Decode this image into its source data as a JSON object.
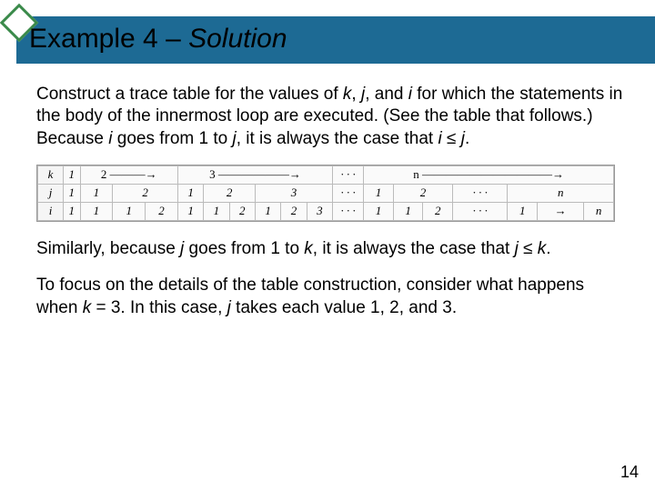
{
  "header": {
    "title_prefix": "Example 4",
    "title_sep": " – ",
    "title_suffix": "Solution"
  },
  "paragraphs": {
    "p1_a": "Construct a trace table for the values of ",
    "p1_k": "k",
    "p1_b": ", ",
    "p1_j": "j",
    "p1_c": ", and ",
    "p1_i": "i",
    "p1_d": " for which the statements in the body of the innermost loop are executed. (See the table that follows.) Because ",
    "p1_i2": "i",
    "p1_e": " goes from 1 to ",
    "p1_j2": "j",
    "p1_f": ", it is always the case that ",
    "p1_i3": "i",
    "p1_g": " ≤ ",
    "p1_j3": "j",
    "p1_h": ".",
    "p2_a": "Similarly, because ",
    "p2_j": "j",
    "p2_b": " goes from 1 to ",
    "p2_k": "k",
    "p2_c": ", it is always the case that ",
    "p2_j2": "j",
    "p2_d": " ≤ ",
    "p2_k2": "k",
    "p2_e": ".",
    "p3_a": "To focus on the details of the table construction, consider what happens when ",
    "p3_k": "k",
    "p3_b": " = 3. In this case, ",
    "p3_j": "j",
    "p3_c": " takes each value 1, 2, and 3."
  },
  "trace_table": {
    "row_labels": [
      "k",
      "j",
      "i"
    ],
    "k_row": [
      "1",
      "2 ———→",
      "3 ——————→",
      "· · ·",
      "n ———————————→"
    ],
    "j_row": [
      "1",
      "1",
      "2",
      "1",
      "2",
      "3",
      "· · ·",
      "1",
      "2",
      "· · ·",
      "n"
    ],
    "i_row": [
      "1",
      "1",
      "1",
      "2",
      "1",
      "1",
      "2",
      "1",
      "2",
      "3",
      "· · ·",
      "1",
      "1",
      "2",
      "· · ·",
      "1",
      "→",
      "n"
    ]
  },
  "page_number": "14"
}
